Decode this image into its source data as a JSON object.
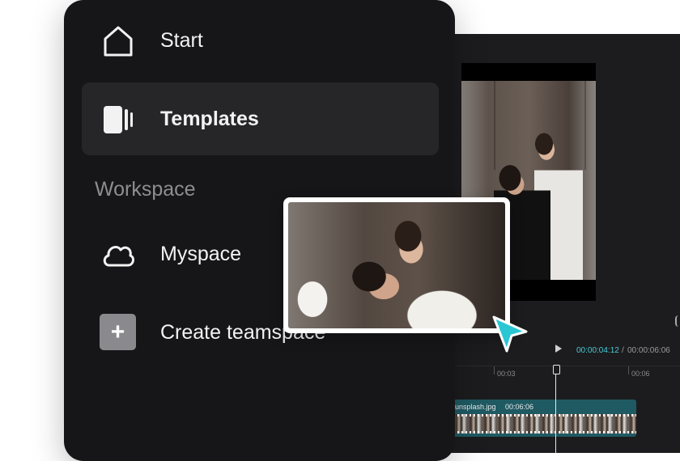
{
  "sidebar": {
    "items": [
      {
        "label": "Start",
        "icon": "home-icon"
      },
      {
        "label": "Templates",
        "icon": "templates-icon",
        "active": true
      },
      {
        "label": "Myspace",
        "icon": "cloud-icon"
      },
      {
        "label": "Create teamspace",
        "icon": "plus-icon"
      }
    ],
    "section_label": "Workspace"
  },
  "editor": {
    "timecode_current": "00:00:04:12",
    "timecode_separator": "/",
    "timecode_total": "00:00:06:06",
    "ruler_ticks": [
      "00:03",
      "00:06"
    ],
    "clip": {
      "name": "unsplash.jpg",
      "duration": "00:06:06"
    }
  },
  "colors": {
    "accent": "#4ac9d6",
    "sidebar_bg": "#161618",
    "active_item_bg": "#262628",
    "clip_bg": "#1f5a63",
    "cursor": "#29c6d4"
  }
}
